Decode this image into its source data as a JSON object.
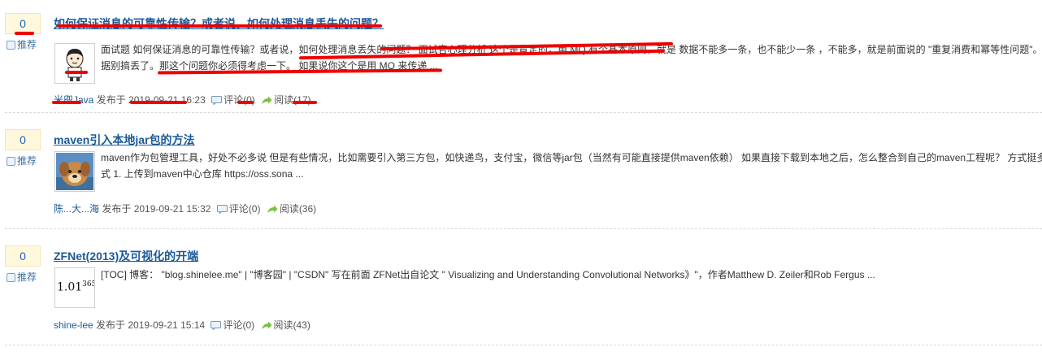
{
  "posts": [
    {
      "digg_count": "0",
      "recommend_label": "推荐",
      "title": "如何保证消息的可靠性传输？或者说，如何处理消息丢失的问题？",
      "summary_line1": "面试题 如何保证消息的可靠性传输？或者说，如何处理消息丢失的问题？ 面试官心理分析 这个是肯定的，用 MQ 有个基本原则，就是 数据不能多一条，也不能少一条 ，不能多，就是前面说的 \"重复消费和幂等性问题\"。不",
      "summary_line2": "据别搞丢了。那这个问题你必须得考虑一下。 如果说你这个是用 MQ 来传递 ...",
      "author": "米兜Java",
      "posted_text": "发布于 2019-09-21 16:23",
      "comments": "评论(0)",
      "reads": "阅读(17)",
      "avatar": "cartoon-boy"
    },
    {
      "digg_count": "0",
      "recommend_label": "推荐",
      "title": "maven引入本地jar包的方法",
      "summary_line1": "maven作为包管理工具，好处不必多说 但是有些情况，比如需要引入第三方包，如快递鸟，支付宝，微信等jar包（当然有可能直接提供maven依赖） 如果直接下载到本地之后，怎么整合到自己的maven工程呢？ 方式挺多",
      "summary_line2": "式 1. 上传到maven中心仓库 https://oss.sona ...",
      "author": "陈...大...海",
      "posted_text": "发布于 2019-09-21 15:32",
      "comments": "评论(0)",
      "reads": "阅读(36)",
      "avatar": "dog-photo"
    },
    {
      "digg_count": "0",
      "recommend_label": "推荐",
      "title": "ZFNet(2013)及可视化的开端",
      "summary_line1": "[TOC] 博客： \"blog.shinelee.me\" | \"博客园\" | \"CSDN\" 写在前面 ZFNet出自论文 \" Visualizing and Understanding Convolutional Networks》\"，作者Matthew D. Zeiler和Rob Fergus ...",
      "summary_line2": "",
      "author": "shine-lee",
      "posted_text": "发布于 2019-09-21 15:14",
      "comments": "评论(0)",
      "reads": "阅读(43)",
      "avatar_text_base": "1.01",
      "avatar_text_exp": "365"
    }
  ],
  "colors": {
    "link": "#1a5a9a",
    "digg_bg": "#fff8dd",
    "annotation": "#ee0000"
  }
}
